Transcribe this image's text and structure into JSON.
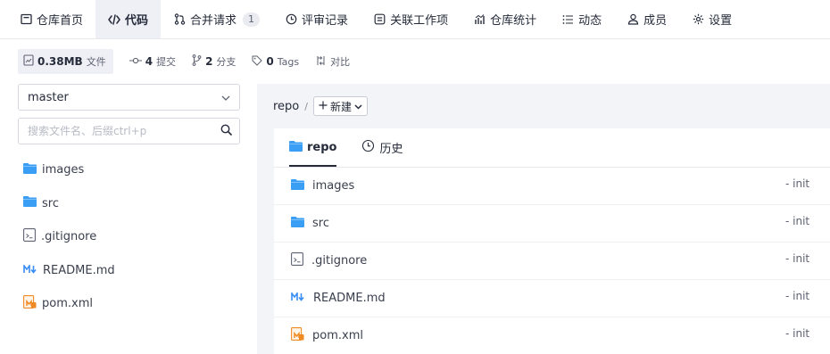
{
  "nav": {
    "tabs": [
      {
        "label": "仓库首页",
        "icon": "home-icon"
      },
      {
        "label": "代码",
        "icon": "code-icon"
      },
      {
        "label": "合并请求",
        "icon": "merge-icon",
        "badge": "1"
      },
      {
        "label": "评审记录",
        "icon": "review-icon"
      },
      {
        "label": "关联工作项",
        "icon": "workitem-icon"
      },
      {
        "label": "仓库统计",
        "icon": "stats-icon"
      },
      {
        "label": "动态",
        "icon": "activity-icon"
      },
      {
        "label": "成员",
        "icon": "member-icon"
      },
      {
        "label": "设置",
        "icon": "settings-icon"
      }
    ],
    "active_index": 1
  },
  "stats": {
    "size_value": "0.38MB",
    "size_label": "文件",
    "commits_value": "4",
    "commits_label": "提交",
    "branches_value": "2",
    "branches_label": "分支",
    "tags_value": "0",
    "tags_label": "Tags",
    "compare_label": "对比"
  },
  "left": {
    "branch": "master",
    "search_placeholder": "搜索文件名、后缀ctrl+p",
    "tree": [
      {
        "name": "images",
        "type": "folder"
      },
      {
        "name": "src",
        "type": "folder"
      },
      {
        "name": ".gitignore",
        "type": "file"
      },
      {
        "name": "README.md",
        "type": "markdown"
      },
      {
        "name": "pom.xml",
        "type": "maven"
      }
    ]
  },
  "right": {
    "breadcrumb_repo": "repo",
    "breadcrumb_sep": "/",
    "new_button": "新建",
    "tabs": [
      {
        "label": "repo",
        "icon": "folder-icon"
      },
      {
        "label": "历史",
        "icon": "history-icon"
      }
    ],
    "files": [
      {
        "name": "images",
        "type": "folder",
        "message": "- init"
      },
      {
        "name": "src",
        "type": "folder",
        "message": "- init"
      },
      {
        "name": ".gitignore",
        "type": "file",
        "message": "- init"
      },
      {
        "name": "README.md",
        "type": "markdown",
        "message": "- init"
      },
      {
        "name": "pom.xml",
        "type": "maven",
        "message": "- init"
      }
    ]
  },
  "colors": {
    "folder": "#3a9ef5",
    "markdown": "#3a8ef5",
    "maven": "#f08a24",
    "text": "#252b3a",
    "panel_bg": "#f3f4f7"
  }
}
